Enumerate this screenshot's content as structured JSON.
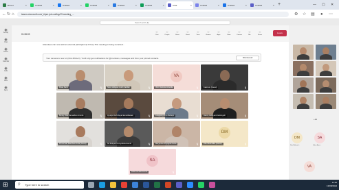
{
  "browser": {
    "tabs": [
      {
        "title": "Brevet",
        "color": "#2d7d46"
      },
      {
        "title": "Untitled",
        "color": "#25d366"
      },
      {
        "title": "Untitled",
        "color": "#1877f2"
      },
      {
        "title": "Untitled",
        "color": "#25d366"
      },
      {
        "title": "Untitled",
        "color": "#2a7ae2"
      },
      {
        "title": "Untitled",
        "color": "#0f9d58"
      },
      {
        "title": "Chat",
        "color": "#5b5fc7"
      },
      {
        "title": "Untitled",
        "color": "#7b83eb"
      },
      {
        "title": "Untitled",
        "color": "#1a73e8"
      },
      {
        "title": "Untitled",
        "color": "#5b5fc7"
      }
    ],
    "url": "teams.microsoft.com/_#/pre-join-calling/19:meeting_...",
    "new_tab": "+"
  },
  "teams": {
    "search_placeholder": "Search (Ctrl+E)",
    "rail": [
      "Activity",
      "Chat",
      "Teams",
      "Calendar",
      "Calls",
      "Files",
      "Apps"
    ],
    "meeting_title": "01:36:03",
    "header_buttons": [
      "Chat",
      "People",
      "Raise",
      "React",
      "View",
      "Rooms",
      "Apps",
      "More",
      "Camera",
      "Mic",
      "Share"
    ],
    "leave_label": "Leave",
    "notice": "Attendees can now add an external participant (0.0 free) This meeting is being recorded...",
    "chat_notice": "Your camera is now on (Ctrl+Shift+O). You'll only get notifications for @mentions, messages and from your pinned contacts.",
    "chat_dismiss": "Dismiss all"
  },
  "grid": {
    "participants": [
      {
        "name": "Rosa Santi",
        "initials": "",
        "kind": "photo",
        "bg": "#cfcac2",
        "skin": "#b98d6e",
        "cloth": "#6d6b7b"
      },
      {
        "name": "Nurul Hidayati Indah Fadilah",
        "initials": "",
        "kind": "photo",
        "bg": "#d7d0c4",
        "skin": "#c89a7b",
        "cloth": "#d1c7b8"
      },
      {
        "name": "Vivit Vanlenia Akreidia",
        "initials": "VA",
        "kind": "avatar",
        "bg": "#f5ddd8",
        "fg": "#8a3b2f"
      },
      {
        "name": "Kasimon (Guest)",
        "initials": "",
        "kind": "photo",
        "bg": "#3a3a3a",
        "skin": "#8a6a55",
        "cloth": "#2b2b2b"
      },
      {
        "name": "Bundy Risa Ramadhan Amzah",
        "initials": "",
        "kind": "photo",
        "bg": "#bfb9b0",
        "skin": "#a77c60",
        "cloth": "#2e2e2e"
      },
      {
        "name": "Ayudya Nurhidayat Esmailliawati",
        "initials": "",
        "kind": "photo",
        "bg": "#5a4a3e",
        "skin": "#a57a5c",
        "cloth": "#2a2f3b"
      },
      {
        "name": "Langgeng Aryo Raharjo",
        "initials": "",
        "kind": "photo",
        "bg": "#e8ddd2",
        "skin": "#c59a7e",
        "cloth": "#6c7a8a"
      },
      {
        "name": "Hanny Hidayanti Jatiningsih",
        "initials": "",
        "kind": "photo",
        "bg": "#a58d78",
        "skin": "#b88d70",
        "cloth": "#1f1f1f"
      },
      {
        "name": "Prima Sari Wardhani Aulia (Guest)",
        "initials": "",
        "kind": "photo",
        "bg": "#e2e0dd",
        "skin": "#a87a5d",
        "cloth": "#d8d4cf"
      },
      {
        "name": "Sri Mulyani Nursyahida Hamid",
        "initials": "",
        "kind": "photo",
        "bg": "#5a5a5a",
        "skin": "#b48a6b",
        "cloth": "#3a3a3a"
      },
      {
        "name": "Maryanita Dhiyagita Kanta",
        "initials": "",
        "kind": "photo",
        "bg": "#cbb6a6",
        "skin": "#b08468",
        "cloth": "#d0c2b7"
      },
      {
        "name": "Dita Melandika (Guest)",
        "initials": "DM",
        "kind": "avatar",
        "bg": "#f4e7c8",
        "fg": "#7a5a14"
      },
      {
        "name": "Salsa Amalia Azizah",
        "initials": "SA",
        "kind": "avatar",
        "bg": "#f6dadc",
        "fg": "#8a2f3a"
      }
    ]
  },
  "right_panel": {
    "thumbs": [
      {
        "bg": "#c8b8a6",
        "skin": "#b58a6d"
      },
      {
        "bg": "#6e7f90",
        "skin": "#a87f62"
      },
      {
        "bg": "#8a7060",
        "skin": "#b48a6c"
      },
      {
        "bg": "#d4c7b8",
        "skin": "#c29a7d"
      },
      {
        "bg": "#b0a49a",
        "skin": "#a17558"
      },
      {
        "bg": "#7d6b5c",
        "skin": "#b58d70"
      },
      {
        "bg": "#c5bdb1",
        "skin": "#b08466"
      },
      {
        "bg": "#9a8876",
        "skin": "#a97e61"
      }
    ],
    "more_count": "+30",
    "avatars": [
      {
        "initials": "DM",
        "label": "Dita Melandi...",
        "bg": "#f4e7c8",
        "fg": "#7a5a14"
      },
      {
        "initials": "SA",
        "label": "Salsa Ama...",
        "bg": "#f6dadc",
        "fg": "#8a2f3a"
      },
      {
        "initials": "VA",
        "label": "",
        "bg": "#f5ddd8",
        "fg": "#8a3b2f"
      }
    ]
  },
  "taskbar": {
    "search_placeholder": "Type here to search",
    "icons": [
      {
        "name": "task-view",
        "color": "#9aa6b2"
      },
      {
        "name": "edge",
        "color": "#1b9de2"
      },
      {
        "name": "file-explorer",
        "color": "#f3c23c"
      },
      {
        "name": "chrome",
        "color": "#e94235"
      },
      {
        "name": "store",
        "color": "#3c83d9"
      },
      {
        "name": "word",
        "color": "#2b579a"
      },
      {
        "name": "excel",
        "color": "#217346"
      },
      {
        "name": "powerpoint",
        "color": "#d24726"
      },
      {
        "name": "teams",
        "color": "#5b5fc7"
      },
      {
        "name": "zoom",
        "color": "#2d8cff"
      },
      {
        "name": "whatsapp",
        "color": "#25d366"
      },
      {
        "name": "photos",
        "color": "#c94f9b"
      }
    ],
    "time": "11:26",
    "date": "13/08/2024"
  }
}
